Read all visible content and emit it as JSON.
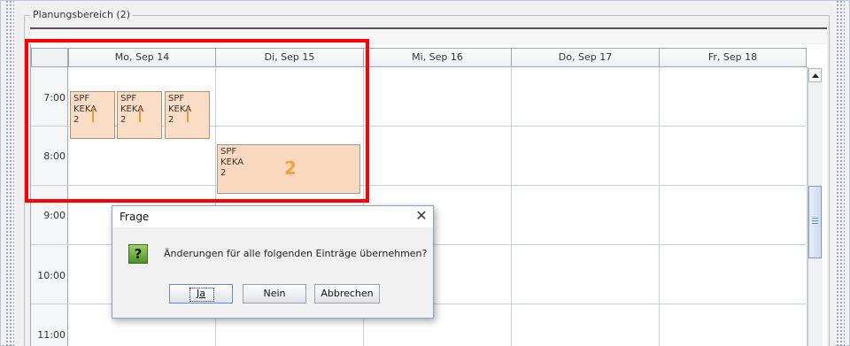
{
  "group": {
    "title": "Planungsbereich (2)"
  },
  "calendar": {
    "days": [
      "Mo, Sep 14",
      "Di, Sep 15",
      "Mi, Sep 16",
      "Do, Sep 17",
      "Fr, Sep 18"
    ],
    "times": [
      "7:00",
      "8:00",
      "9:00",
      "10:00",
      "11:00"
    ],
    "small_entries": [
      {
        "line1": "SPF",
        "line2": "KEKA",
        "line3": "2"
      },
      {
        "line1": "SPF",
        "line2": "KEKA",
        "line3": "2"
      },
      {
        "line1": "SPF",
        "line2": "KEKA",
        "line3": "2"
      }
    ],
    "big_entry": {
      "line1": "SPF",
      "line2": "KEKA",
      "line3": "2",
      "marker": "2"
    }
  },
  "dialog": {
    "title": "Frage",
    "close": "✕",
    "icon": "?",
    "message": "Änderungen für alle folgenden Einträge übernehmen?",
    "buttons": {
      "yes": "Ja",
      "no": "Nein",
      "cancel": "Abbrechen"
    }
  },
  "colors": {
    "highlight": "#ff0000",
    "entry": "#fbdcc4",
    "accent": "#f0a33c"
  }
}
